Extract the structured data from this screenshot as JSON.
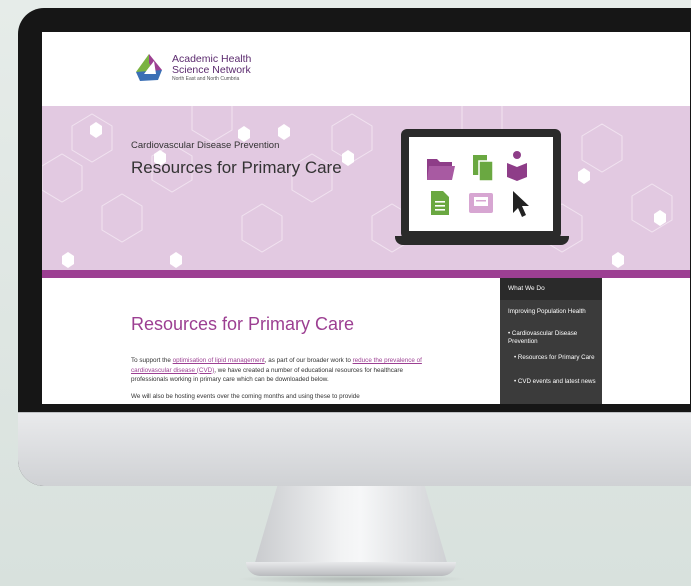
{
  "site": {
    "logo": {
      "line1": "Academic Health",
      "line2": "Science Network",
      "line3": "North East and North Cumbria"
    },
    "hero": {
      "eyebrow": "Cardiovascular Disease Prevention",
      "title": "Resources for Primary Care"
    },
    "main": {
      "title": "Resources for Primary Care",
      "para_prefix": "To support the ",
      "link1": "optimisation of lipid management",
      "para_mid": ", as part of our broader work to ",
      "link2": "reduce the prevalence of cardiovascular disease (CVD)",
      "para_suffix": ", we have created a number of educational resources for healthcare professionals working in primary care which can be downloaded below.",
      "para2": "We will also be hosting events over the coming months and using these to provide"
    },
    "sidebar": {
      "heading": "What We Do",
      "items": [
        {
          "label": "Improving Population Health"
        },
        {
          "label": "• Cardiovascular Disease Prevention"
        },
        {
          "label": "• Resources for Primary Care"
        },
        {
          "label": "• CVD events and latest news"
        }
      ]
    }
  },
  "colors": {
    "brand_purple": "#9c3f92",
    "hero_pink": "#e2c9e1",
    "icon_green": "#6aa841",
    "icon_purple": "#8e3d88",
    "sidebar_dark": "#3b3b3b"
  },
  "icons": [
    "folder-icon",
    "documents-icon",
    "reader-icon",
    "document-icon",
    "envelope-icon",
    "cursor-icon"
  ]
}
